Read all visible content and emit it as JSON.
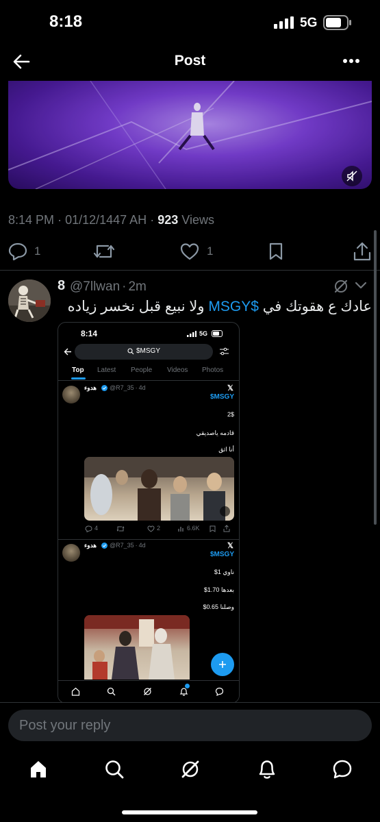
{
  "status_bar": {
    "time": "8:18",
    "network": "5G"
  },
  "header": {
    "title": "Post"
  },
  "meta": {
    "time": "8:14 PM",
    "sep": "·",
    "date": "01/12/1447 AH",
    "views_count": "923",
    "views_label": "Views"
  },
  "actions": {
    "replies": "1",
    "likes": "1"
  },
  "reply": {
    "name": "8",
    "handle": "@7llwan",
    "age": "2m",
    "text_part1": "عادك ع هقوتك في ",
    "cashtag": "$MSGY",
    "text_part2": " ولا نبيع قبل نخسر زياده"
  },
  "embedded_screenshot": {
    "status_time": "8:14",
    "status_network": "5G",
    "search_query": "$MSGY",
    "tabs": [
      "Top",
      "Latest",
      "People",
      "Videos",
      "Photos"
    ],
    "post1": {
      "name": "هدوء",
      "handle": "@R7_35",
      "age": "4d",
      "cashtag": "$MSGY",
      "lines": [
        "2$",
        "قادمه ياصديقي",
        "أنا اثق"
      ],
      "stats": {
        "replies": "4",
        "likes": "2",
        "views": "6.6K"
      }
    },
    "post2": {
      "name": "هدوء",
      "handle": "@R7_35",
      "age": "4d",
      "cashtag": "$MSGY",
      "lines": [
        "ناوي 1$",
        "بعدها 1.70$",
        "وصلنا 0.65$"
      ]
    }
  },
  "composer": {
    "placeholder": "Post your reply"
  },
  "colors": {
    "accent": "#1d9bf0",
    "background": "#000000",
    "muted": "#71767b"
  }
}
